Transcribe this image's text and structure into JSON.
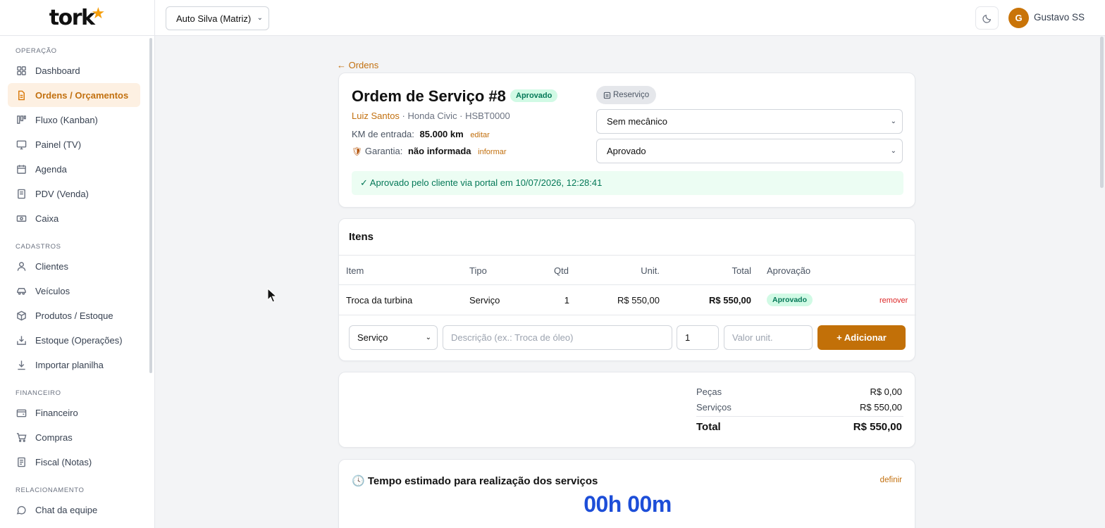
{
  "brand": {
    "logo_text": "tork",
    "logo_star": "★"
  },
  "topbar": {
    "shop": "Auto Silva (Matriz)",
    "theme_icon": "moon-icon",
    "avatar_initial": "G",
    "user_name": "Gustavo SS"
  },
  "sidebar": {
    "sections": [
      {
        "title": "OPERAÇÃO"
      },
      {
        "title": "CADASTROS"
      },
      {
        "title": "FINANCEIRO"
      },
      {
        "title": "RELACIONAMENTO"
      }
    ],
    "items": [
      {
        "label": "Dashboard",
        "icon": "grid-icon"
      },
      {
        "label": "Ordens / Orçamentos",
        "icon": "document-icon",
        "active": true
      },
      {
        "label": "Fluxo (Kanban)",
        "icon": "kanban-icon"
      },
      {
        "label": "Painel (TV)",
        "icon": "monitor-icon"
      },
      {
        "label": "Agenda",
        "icon": "calendar-icon"
      },
      {
        "label": "PDV (Venda)",
        "icon": "receipt-icon"
      },
      {
        "label": "Caixa",
        "icon": "cash-icon"
      },
      {
        "label": "Clientes",
        "icon": "user-icon"
      },
      {
        "label": "Veículos",
        "icon": "car-icon"
      },
      {
        "label": "Produtos / Estoque",
        "icon": "box-icon"
      },
      {
        "label": "Estoque (Operações)",
        "icon": "inbox-icon"
      },
      {
        "label": "Importar planilha",
        "icon": "download-icon"
      },
      {
        "label": "Financeiro",
        "icon": "wallet-icon"
      },
      {
        "label": "Compras",
        "icon": "cart-icon"
      },
      {
        "label": "Fiscal (Notas)",
        "icon": "file-text-icon"
      },
      {
        "label": "Chat da equipe",
        "icon": "chat-icon"
      }
    ]
  },
  "order": {
    "back_link": "← Ordens",
    "title": "Ordem de Serviço #8",
    "status_badge": "Aprovado",
    "customer": "Luiz Santos",
    "vehicle_line": " · Honda Civic · HSBT0000",
    "km_label": "KM de entrada:",
    "km_value": "85.000 km",
    "km_edit": "editar",
    "warranty_label": "Garantia:",
    "warranty_value": "não informada",
    "warranty_link": "informar",
    "reserve_button": "Reserviço",
    "mechanic_select": "Sem mecânico",
    "status_select": "Aprovado",
    "approval_banner": "✓ Aprovado pelo cliente via portal em 10/07/2026, 12:28:41"
  },
  "items": {
    "heading": "Itens",
    "columns": [
      "Item",
      "Tipo",
      "Qtd",
      "Unit.",
      "Total",
      "Aprovação"
    ],
    "rows": [
      {
        "item": "Troca da turbina",
        "tipo": "Serviço",
        "qtd": "1",
        "unit": "R$ 550,00",
        "total": "R$ 550,00",
        "aprovacao": "Aprovado",
        "remove": "remover"
      }
    ],
    "form": {
      "type_value": "Serviço",
      "desc_placeholder": "Descrição (ex.: Troca de óleo)",
      "qty_value": "1",
      "unit_placeholder": "Valor unit.",
      "add_button": "+ Adicionar"
    }
  },
  "totals": {
    "parts_label": "Peças",
    "parts_value": "R$ 0,00",
    "services_label": "Serviços",
    "services_value": "R$ 550,00",
    "total_label": "Total",
    "total_value": "R$ 550,00"
  },
  "time": {
    "title": "Tempo estimado para realização dos serviços",
    "define_link": "definir",
    "value": "00h 00m"
  }
}
